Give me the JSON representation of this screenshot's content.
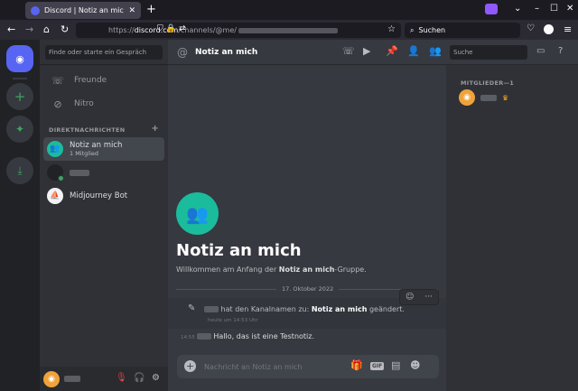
{
  "browser": {
    "tab_title": "Discord | Notiz an mich",
    "url_prefix": "https://",
    "url_domain": "discord.com",
    "url_path": "/channels/@me/",
    "search_placeholder": "Suchen"
  },
  "sidebar": {
    "search_placeholder": "Finde oder starte ein Gespräch",
    "nav": [
      {
        "label": "Freunde"
      },
      {
        "label": "Nitro"
      }
    ],
    "dm_header": "DIREKTNACHRICHTEN",
    "dms": [
      {
        "name": "Notiz an mich",
        "sub": "1 Mitglied"
      },
      {
        "name": "Midjourney Bot"
      }
    ]
  },
  "channel": {
    "title": "Notiz an mich",
    "hero_title": "Notiz an mich",
    "welcome_pre": "Willkommen am Anfang der ",
    "welcome_bold": "Notiz an mich",
    "welcome_post": "-Gruppe.",
    "date_divider": "17. Oktober 2022",
    "system_text": "hat den Kanalnamen zu:",
    "system_bold": "Notiz an mich",
    "system_post": "geändert.",
    "system_time": "heute um 14:53 Uhr",
    "message_time": "14:55",
    "message_text": "Hallo, das ist eine Testnotiz.",
    "composer_placeholder": "Nachricht an Notiz an mich"
  },
  "members": {
    "search_placeholder": "Suche",
    "header": "MITGLIEDER—1"
  },
  "colors": {
    "blurple": "#5865f2",
    "teal": "#1abc9c",
    "green": "#3ba55d",
    "orange": "#f0a33a"
  }
}
